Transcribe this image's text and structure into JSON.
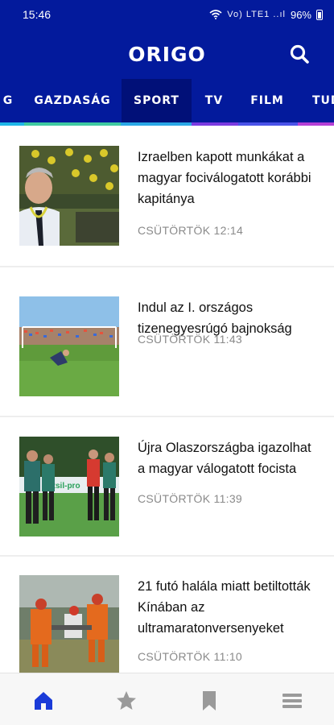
{
  "status_bar": {
    "time": "15:46",
    "signal_text": "Vo) LTE1 ..ıl",
    "battery": "96%"
  },
  "header": {
    "logo": "ORIGO",
    "search_icon": "search-icon"
  },
  "tabs": [
    {
      "label": "G"
    },
    {
      "label": "GAZDASÁG"
    },
    {
      "label": "SPORT",
      "active": true
    },
    {
      "label": "TV"
    },
    {
      "label": "FILM"
    },
    {
      "label": "TUD"
    }
  ],
  "articles": [
    {
      "title": "Izraelben kapott munkákat a magyar fociválogatott korábbi kapitánya",
      "time": "CSÜTÖRTÖK 12:14"
    },
    {
      "title": "Indul az I. országos tizenegyesrúgó bajnokság",
      "time": "CSÜTÖRTÖK 11:43"
    },
    {
      "title": "Újra Olaszországba igazolhat a magyar válogatott focista",
      "time": "CSÜTÖRTÖK 11:39"
    },
    {
      "title": "21 futó halála miatt betiltották Kínában az ultramaratonversenyeket",
      "time": "CSÜTÖRTÖK 11:10"
    }
  ],
  "bottom_nav": [
    {
      "icon": "home-icon",
      "active": true
    },
    {
      "icon": "star-icon"
    },
    {
      "icon": "bookmark-icon"
    },
    {
      "icon": "menu-icon"
    }
  ],
  "colors": {
    "brand_blue": "#031a9c",
    "active_tab": "#011078",
    "accent_blue": "#1a3bd8",
    "inactive_icon": "#9a9a9a"
  }
}
